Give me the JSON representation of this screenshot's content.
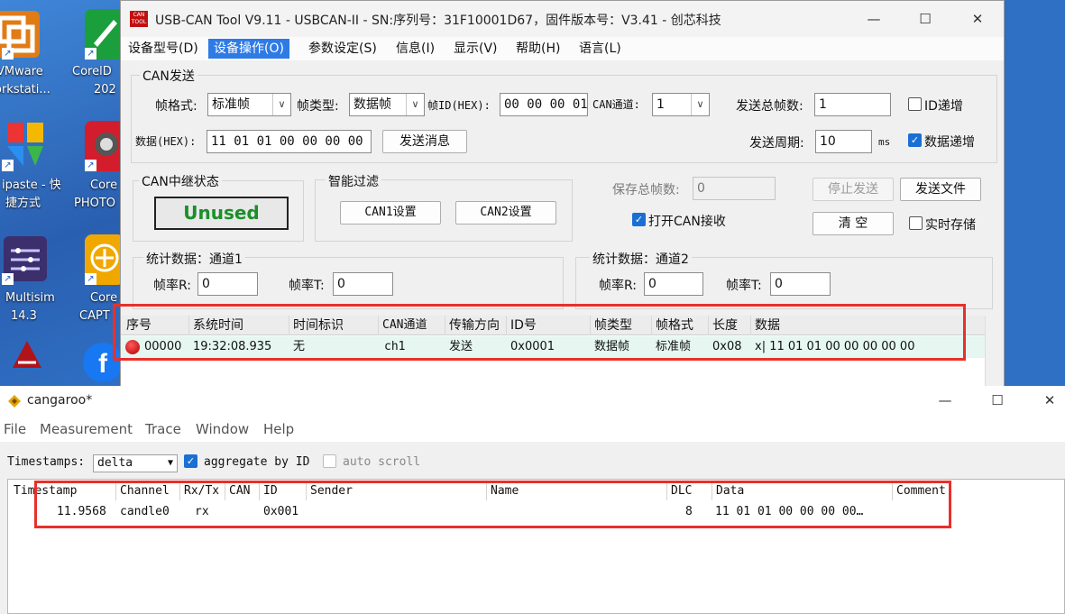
{
  "desktop": {
    "icons": [
      {
        "label_line1": "VMware",
        "label_line2": "orkstati..."
      },
      {
        "label_line1": "CorelD",
        "label_line2": "202"
      },
      {
        "label_line1": "ipaste - 快",
        "label_line2": "捷方式"
      },
      {
        "label_line1": "Core",
        "label_line2": "PHOTO"
      },
      {
        "label_line1": "Multisim",
        "label_line2": "14.3"
      },
      {
        "label_line1": "Core",
        "label_line2": "CAPT"
      }
    ]
  },
  "usbcan": {
    "app_icon_text": "CAN TOOL",
    "title": "USB-CAN Tool V9.11 - USBCAN-II - SN:序列号：31F10001D67，固件版本号：V3.41 - 创芯科技",
    "menu": [
      "设备型号(D)",
      "设备操作(O)",
      "参数设定(S)",
      "信息(I)",
      "显示(V)",
      "帮助(H)",
      "语言(L)"
    ],
    "send_group": {
      "label": "CAN发送",
      "frame_format_label": "帧格式:",
      "frame_format_value": "标准帧",
      "frame_type_label": "帧类型:",
      "frame_type_value": "数据帧",
      "frame_id_label": "帧ID(HEX):",
      "frame_id_value": "00 00 00 01",
      "channel_label": "CAN通道:",
      "channel_value": "1",
      "total_frames_label": "发送总帧数:",
      "total_frames_value": "1",
      "id_increment_label": "ID递增",
      "id_increment_checked": false,
      "data_label": "数据(HEX):",
      "data_value": "11 01 01 00 00 00 00 00",
      "send_button": "发送消息",
      "period_label": "发送周期:",
      "period_value": "10",
      "period_unit": "ms",
      "data_increment_label": "数据递增",
      "data_increment_checked": true
    },
    "relay": {
      "label": "CAN中继状态",
      "status": "Unused"
    },
    "filter": {
      "label": "智能过滤",
      "can1_button": "CAN1设置",
      "can2_button": "CAN2设置"
    },
    "save_total_label": "保存总帧数:",
    "save_total_value": "0",
    "stop_send_button": "停止发送",
    "send_file_button": "发送文件",
    "open_can_receive_label": "打开CAN接收",
    "open_can_receive_checked": true,
    "clear_button": "清 空",
    "realtime_save_label": "实时存储",
    "realtime_save_checked": false,
    "stats1": {
      "label": "统计数据：通道1",
      "rate_r_label": "帧率R:",
      "rate_r_value": "0",
      "rate_t_label": "帧率T:",
      "rate_t_value": "0"
    },
    "stats2": {
      "label": "统计数据：通道2",
      "rate_r_label": "帧率R:",
      "rate_r_value": "0",
      "rate_t_label": "帧率T:",
      "rate_t_value": "0"
    },
    "grid": {
      "headers": [
        "序号",
        "系统时间",
        "时间标识",
        "CAN通道",
        "传输方向",
        "ID号",
        "帧类型",
        "帧格式",
        "长度",
        "数据"
      ],
      "rows": [
        {
          "seq": "00000",
          "sys_time": "19:32:08.935",
          "time_flag": "无",
          "channel": "ch1",
          "direction": "发送",
          "id": "0x0001",
          "frame_type": "数据帧",
          "frame_format": "标准帧",
          "length": "0x08",
          "data": "x| 11 01 01 00 00 00 00 00"
        }
      ]
    }
  },
  "cangaroo": {
    "title": "cangaroo*",
    "menu": [
      "File",
      "Measurement",
      "Trace",
      "Window",
      "Help"
    ],
    "timestamps_label": "Timestamps:",
    "timestamps_value": "delta",
    "aggregate_label": "aggregate by ID",
    "aggregate_checked": true,
    "autoscroll_label": "auto scroll",
    "autoscroll_checked": false,
    "table": {
      "headers": [
        "Timestamp",
        "Channel",
        "Rx/Tx",
        "CAN",
        "ID",
        "Sender",
        "Name",
        "DLC",
        "Data",
        "Comment"
      ],
      "rows": [
        {
          "timestamp": "11.9568",
          "channel": "candle0",
          "rxtx": "rx",
          "can": "",
          "id": "0x001",
          "sender": "",
          "name": "",
          "dlc": "8",
          "data": "11 01 01 00 00 00 00…",
          "comment": ""
        }
      ]
    }
  },
  "colors": {
    "highlight_box": "#e8302a",
    "accent": "#2e7be6",
    "unused_text": "#1b8f2a"
  }
}
